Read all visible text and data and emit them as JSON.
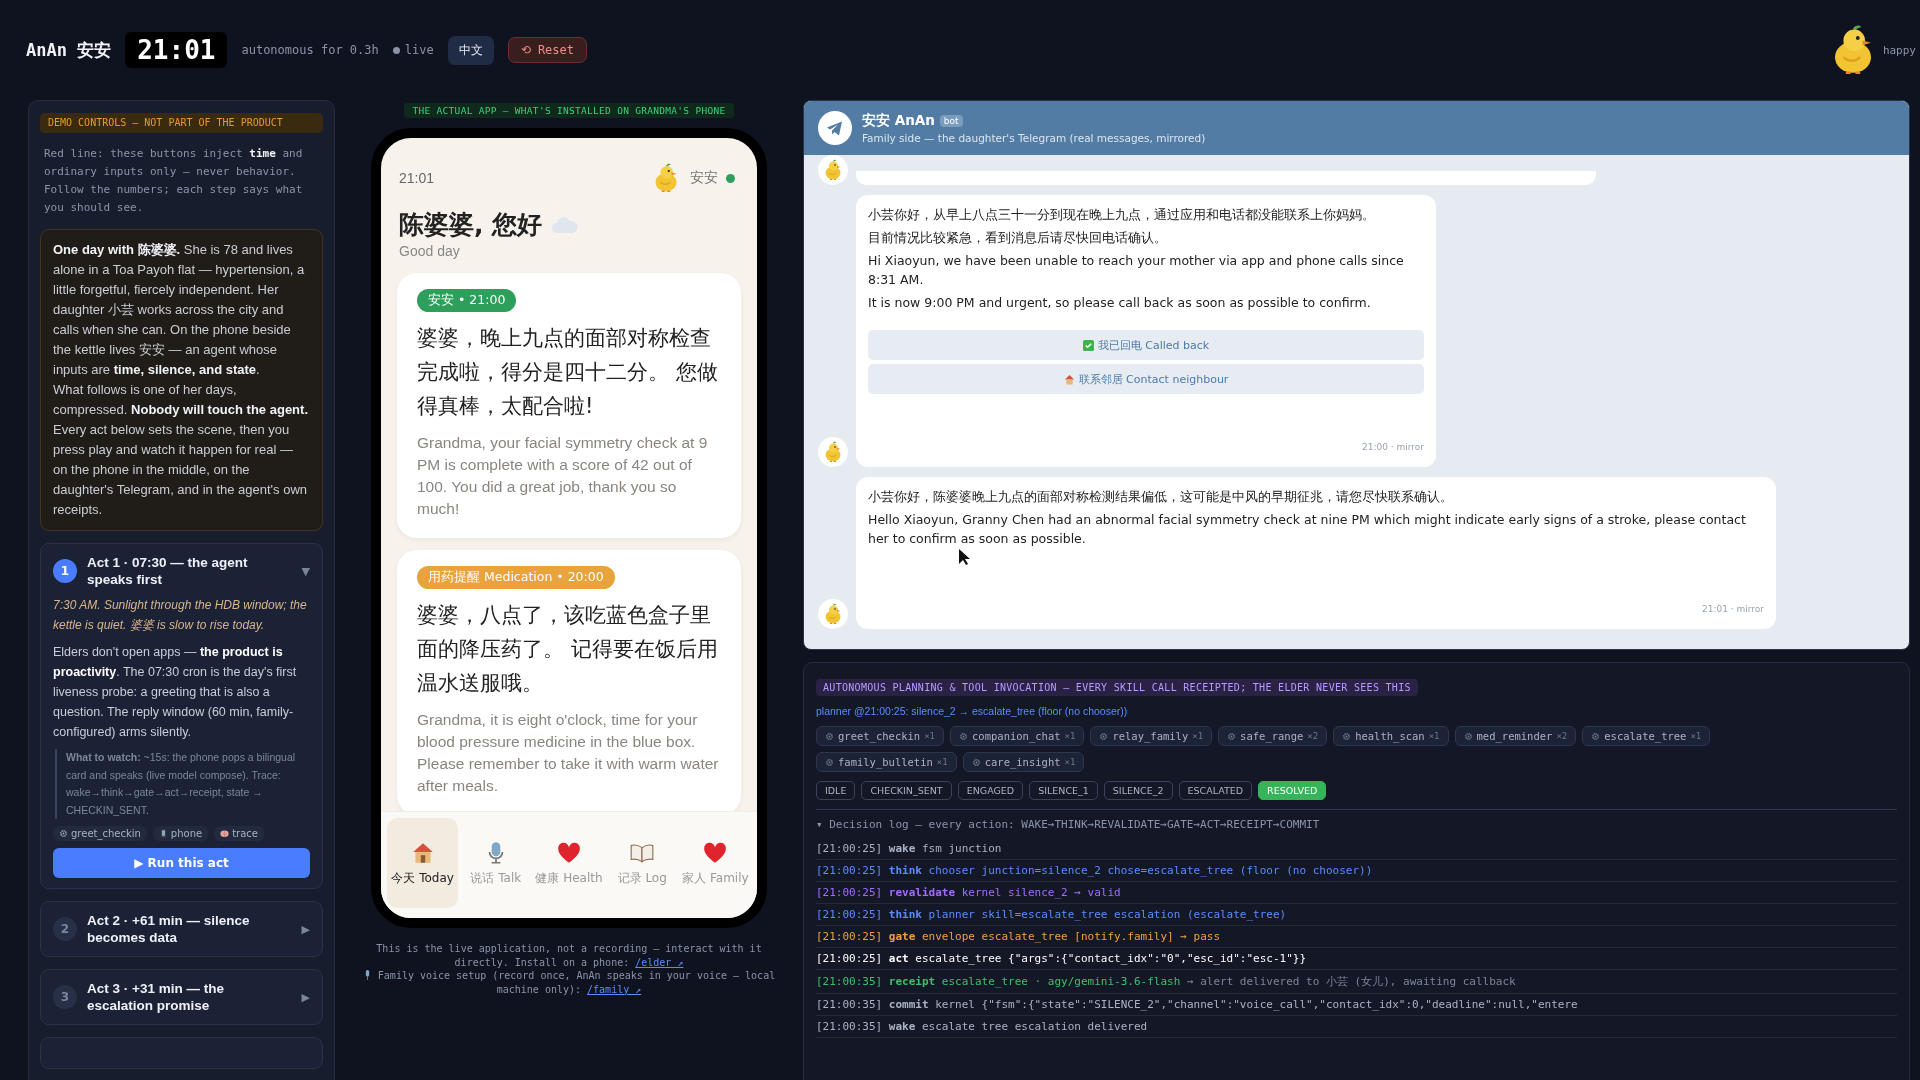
{
  "header": {
    "brand": "AnAn 安安",
    "clock": "21:01",
    "status": "autonomous for 0.3h",
    "live": "live",
    "language_button": "中文",
    "reset_button": "⟲ Reset",
    "mood": "happy"
  },
  "demo": {
    "label": "DEMO CONTROLS — NOT PART OF THE PRODUCT",
    "intro": "Red line: these buttons inject **time** and ordinary inputs only — never behavior. Follow the numbers; each step says what you should see.",
    "story": [
      "**One day with 陈婆婆.** She is 78 and lives alone in a Toa Payoh flat — hypertension, a little forgetful, fiercely independent. Her daughter 小芸 works across the city and calls when she can. On the phone beside the kettle lives 安安 — an agent whose inputs are **time, silence, and state**.",
      "What follows is one of her days, compressed. **Nobody will touch the agent.** Every act below sets the scene, then you press play and watch it happen for real — on the phone in the middle, on the daughter's Telegram, and in the agent's own receipts."
    ],
    "acts": [
      {
        "number": "1",
        "title": "Act 1 · 07:30 — the agent speaks first",
        "toggle": "▼",
        "expanded": true,
        "scene": "7:30 AM. Sunlight through the HDB window; the kettle is quiet. 婆婆 is slow to rise today.",
        "body": "Elders don't open apps — **the product is proactivity**. The 07:30 cron is the day's first liveness probe: a greeting that is also a question. The reply window (60 min, family-configured) arms silently.",
        "watch": "**What to watch:** ~15s: the phone pops a bilingual card and speaks (live model compose). Trace: wake→think→gate→act→receipt, state → CHECKIN_SENT.",
        "tags": [
          {
            "kind": "skill",
            "label": "greet_checkin"
          },
          {
            "kind": "phone",
            "label": "phone"
          },
          {
            "kind": "trace",
            "label": "trace"
          }
        ],
        "run_button": "▶ Run this act"
      },
      {
        "number": "2",
        "title": "Act 2 · +61 min — silence becomes data",
        "toggle": "▶",
        "expanded": false
      },
      {
        "number": "3",
        "title": "Act 3 · +31 min — the escalation promise",
        "toggle": "▶",
        "expanded": false
      }
    ]
  },
  "app": {
    "label": "THE ACTUAL APP — WHAT'S INSTALLED ON GRANDMA'S PHONE",
    "phone": {
      "time": "21:01",
      "agent_name": "安安",
      "online": true,
      "greeting": "陈婆婆, 您好",
      "subtitle": "Good day",
      "cards": [
        {
          "badge": "安安 • 21:00",
          "color": "#2e9e5b",
          "zh": "婆婆，晚上九点的面部对称检查完成啦，得分是四十二分。 您做得真棒，太配合啦!",
          "en": "Grandma, your facial symmetry check at 9 PM is complete with a score of 42 out of 100. You did a great job, thank you so much!"
        },
        {
          "badge": "用药提醒 Medication • 20:00",
          "color": "#e8a33c",
          "zh": "婆婆，八点了，该吃蓝色盒子里面的降压药了。 记得要在饭后用温水送服哦。",
          "en": "Grandma, it is eight o'clock, time for your blood pressure medicine in the blue box. Please remember to take it with warm water after meals."
        }
      ],
      "nav": [
        {
          "kind": "home",
          "label": "今天 Today",
          "selected": true
        },
        {
          "kind": "talk",
          "label": "说话 Talk",
          "selected": false
        },
        {
          "kind": "health",
          "label": "健康 Health",
          "selected": false
        },
        {
          "kind": "log",
          "label": "记录 Log",
          "selected": false
        },
        {
          "kind": "family",
          "label": "家人 Family",
          "selected": false
        }
      ]
    },
    "caption": "This is the live application, not a recording — interact with it directly. Install on a phone:",
    "caption_link": "/elder ↗",
    "voice_note": "Family voice setup (record once, AnAn speaks in your voice — local machine only):",
    "voice_link": "/family ↗"
  },
  "telegram": {
    "title": "安安 AnAn",
    "badge": "bot",
    "subtitle": "Family side — the daughter's Telegram (real messages, mirrored)",
    "messages": [
      {
        "lines": [
          "小芸你好，从早上八点三十一分到现在晚上九点，通过应用和电话都没能联系上你妈妈。",
          "目前情况比较紧急，看到消息后请尽快回电话确认。",
          "Hi Xiaoyun, we have been unable to reach your mother via app and phone calls since 8:31 AM.",
          "It is now 9:00 PM and urgent, so please call back as soon as possible to confirm."
        ],
        "buttons": [
          {
            "kind": "check",
            "label": "我已回电 Called back"
          },
          {
            "kind": "home",
            "label": "联系邻居 Contact neighbour"
          }
        ],
        "meta": "21:00 · mirror"
      },
      {
        "lines": [
          "小芸你好，陈婆婆晚上九点的面部对称检测结果偏低，这可能是中风的早期征兆，请您尽快联系确认。",
          "Hello Xiaoyun, Granny Chen had an abnormal facial symmetry check at nine PM which might indicate early signs of a stroke, please contact her to confirm as soon as possible."
        ],
        "meta": "21:01 · mirror"
      }
    ]
  },
  "planning": {
    "label": "AUTONOMOUS PLANNING & TOOL INVOCATION — EVERY SKILL CALL RECEIPTED; THE ELDER NEVER SEES THIS",
    "planner": "planner @21:00:25: silence_2 → escalate_tree (floor (no chooser))",
    "skills": [
      {
        "name": "greet_checkin",
        "count": "×1"
      },
      {
        "name": "companion_chat",
        "count": "×1"
      },
      {
        "name": "relay_family",
        "count": "×1"
      },
      {
        "name": "safe_range",
        "count": "×2"
      },
      {
        "name": "health_scan",
        "count": "×1"
      },
      {
        "name": "med_reminder",
        "count": "×2"
      },
      {
        "name": "escalate_tree",
        "count": "×1"
      },
      {
        "name": "family_bulletin",
        "count": "×1"
      },
      {
        "name": "care_insight",
        "count": "×1"
      }
    ],
    "states": [
      {
        "label": "IDLE",
        "selected": false
      },
      {
        "label": "CHECKIN_SENT",
        "selected": false
      },
      {
        "label": "ENGAGED",
        "selected": false
      },
      {
        "label": "SILENCE_1",
        "selected": false
      },
      {
        "label": "SILENCE_2",
        "selected": false
      },
      {
        "label": "ESCALATED",
        "selected": false
      },
      {
        "label": "RESOLVED",
        "selected": true
      }
    ],
    "log_title": "▾ Decision log — every action: WAKE→THINK→REVALIDATE→GATE→ACT→RECEIPT→COMMIT",
    "log": [
      {
        "kind": "wake",
        "time": "[21:00:25]",
        "verb": "wake",
        "detail": "fsm junction"
      },
      {
        "kind": "think",
        "time": "[21:00:25]",
        "verb": "think",
        "detail": "chooser junction=silence_2 chose=escalate_tree (floor (no chooser))"
      },
      {
        "kind": "revalidate",
        "time": "[21:00:25]",
        "verb": "revalidate",
        "detail": "kernel silence_2 → valid"
      },
      {
        "kind": "think",
        "time": "[21:00:25]",
        "verb": "think",
        "detail": "planner skill=escalate_tree escalation (escalate_tree)"
      },
      {
        "kind": "gate",
        "time": "[21:00:25]",
        "verb": "gate",
        "detail": "envelope escalate_tree [notify.family] → pass"
      },
      {
        "kind": "act",
        "time": "[21:00:25]",
        "verb": "act",
        "detail": "escalate_tree {\"args\":{\"contact_idx\":\"0\",\"esc_id\":\"esc-1\"}}"
      },
      {
        "kind": "receipt",
        "time": "[21:00:35]",
        "verb": "receipt",
        "detail": "escalate_tree · agy/gemini-3.6-flash",
        "note": "→ alert delivered to 小芸 (女儿), awaiting callback"
      },
      {
        "kind": "commit",
        "time": "[21:00:35]",
        "verb": "commit",
        "detail": "kernel {\"fsm\":{\"state\":\"SILENCE_2\",\"channel\":\"voice_call\",\"contact_idx\":0,\"deadline\":null,\"entere"
      },
      {
        "kind": "wake",
        "time": "[21:00:35]",
        "verb": "wake",
        "detail": "escalate tree escalation delivered"
      }
    ]
  }
}
